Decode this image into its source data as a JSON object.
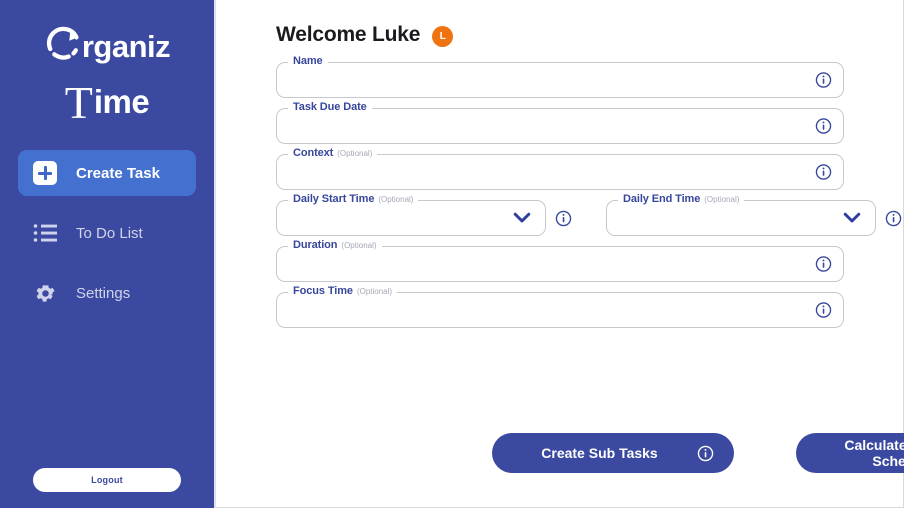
{
  "sidebar": {
    "logo": {
      "word_top": "rganiz",
      "word_bottom_first": "T",
      "word_bottom_rest": "ime",
      "ring_icon": "circular-arrow-icon"
    },
    "items": [
      {
        "id": "create-task",
        "label": "Create Task",
        "icon": "plus-square-icon",
        "active": true
      },
      {
        "id": "to-do-list",
        "label": "To Do List",
        "icon": "list-icon",
        "active": false
      },
      {
        "id": "settings",
        "label": "Settings",
        "icon": "gear-icon",
        "active": false
      }
    ],
    "logout_label": "Logout"
  },
  "header": {
    "greeting": "Welcome Luke",
    "avatar_initial": "L"
  },
  "form": {
    "fields": [
      {
        "id": "name",
        "label": "Name",
        "optional": "",
        "value": "",
        "placeholder": "",
        "type": "text",
        "info": "info-icon"
      },
      {
        "id": "task-due-date",
        "label": "Task Due Date",
        "optional": "",
        "value": "",
        "placeholder": "",
        "type": "text",
        "info": "info-icon"
      },
      {
        "id": "context",
        "label": "Context",
        "optional": "(Optional)",
        "value": "",
        "placeholder": "",
        "type": "text",
        "info": "info-icon"
      },
      {
        "id": "daily-start-time",
        "label": "Daily Start Time",
        "optional": "(Optional)",
        "value": "",
        "placeholder": "",
        "type": "select",
        "info": "info-icon"
      },
      {
        "id": "daily-end-time",
        "label": "Daily End Time",
        "optional": "(Optional)",
        "value": "",
        "placeholder": "",
        "type": "select",
        "info": "info-icon"
      },
      {
        "id": "duration",
        "label": "Duration",
        "optional": "(Optional)",
        "value": "",
        "placeholder": "",
        "type": "text",
        "info": "info-icon"
      },
      {
        "id": "focus-time",
        "label": "Focus Time",
        "optional": "(Optional)",
        "value": "",
        "placeholder": "",
        "type": "text",
        "info": "info-icon"
      }
    ]
  },
  "actions": {
    "create_sub_tasks": "Create Sub Tasks",
    "calculate_optimal_schedule": "Calculate Optimal Schedule"
  },
  "colors": {
    "sidebar_blue": "#3b4aa0",
    "active_item_blue": "#4471cf",
    "label_blue": "#37479c",
    "avatar_orange": "#ef7411",
    "button_blue": "#3b4aa0",
    "field_border": "#c8c9cf",
    "optional_gray": "#a6a8b5"
  }
}
